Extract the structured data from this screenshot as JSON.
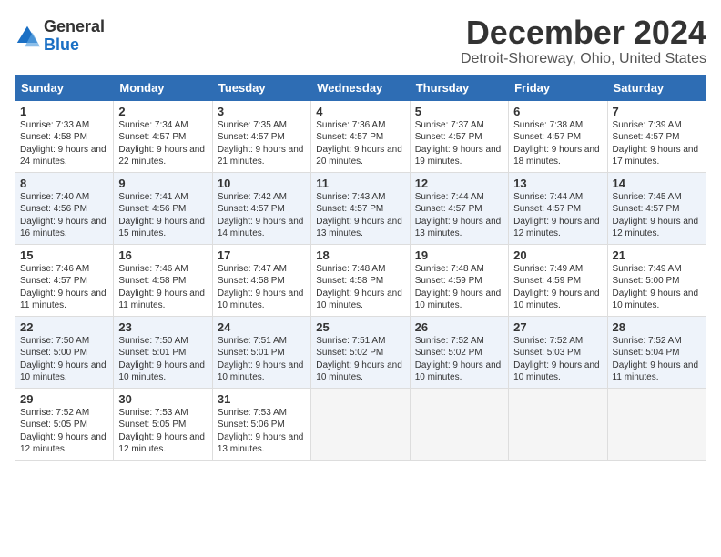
{
  "header": {
    "logo_line1": "General",
    "logo_line2": "Blue",
    "month": "December 2024",
    "location": "Detroit-Shoreway, Ohio, United States"
  },
  "days_of_week": [
    "Sunday",
    "Monday",
    "Tuesday",
    "Wednesday",
    "Thursday",
    "Friday",
    "Saturday"
  ],
  "weeks": [
    [
      {
        "day": "1",
        "sunrise": "7:33 AM",
        "sunset": "4:58 PM",
        "daylight": "9 hours and 24 minutes."
      },
      {
        "day": "2",
        "sunrise": "7:34 AM",
        "sunset": "4:57 PM",
        "daylight": "9 hours and 22 minutes."
      },
      {
        "day": "3",
        "sunrise": "7:35 AM",
        "sunset": "4:57 PM",
        "daylight": "9 hours and 21 minutes."
      },
      {
        "day": "4",
        "sunrise": "7:36 AM",
        "sunset": "4:57 PM",
        "daylight": "9 hours and 20 minutes."
      },
      {
        "day": "5",
        "sunrise": "7:37 AM",
        "sunset": "4:57 PM",
        "daylight": "9 hours and 19 minutes."
      },
      {
        "day": "6",
        "sunrise": "7:38 AM",
        "sunset": "4:57 PM",
        "daylight": "9 hours and 18 minutes."
      },
      {
        "day": "7",
        "sunrise": "7:39 AM",
        "sunset": "4:57 PM",
        "daylight": "9 hours and 17 minutes."
      }
    ],
    [
      {
        "day": "8",
        "sunrise": "7:40 AM",
        "sunset": "4:56 PM",
        "daylight": "9 hours and 16 minutes."
      },
      {
        "day": "9",
        "sunrise": "7:41 AM",
        "sunset": "4:56 PM",
        "daylight": "9 hours and 15 minutes."
      },
      {
        "day": "10",
        "sunrise": "7:42 AM",
        "sunset": "4:57 PM",
        "daylight": "9 hours and 14 minutes."
      },
      {
        "day": "11",
        "sunrise": "7:43 AM",
        "sunset": "4:57 PM",
        "daylight": "9 hours and 13 minutes."
      },
      {
        "day": "12",
        "sunrise": "7:44 AM",
        "sunset": "4:57 PM",
        "daylight": "9 hours and 13 minutes."
      },
      {
        "day": "13",
        "sunrise": "7:44 AM",
        "sunset": "4:57 PM",
        "daylight": "9 hours and 12 minutes."
      },
      {
        "day": "14",
        "sunrise": "7:45 AM",
        "sunset": "4:57 PM",
        "daylight": "9 hours and 12 minutes."
      }
    ],
    [
      {
        "day": "15",
        "sunrise": "7:46 AM",
        "sunset": "4:57 PM",
        "daylight": "9 hours and 11 minutes."
      },
      {
        "day": "16",
        "sunrise": "7:46 AM",
        "sunset": "4:58 PM",
        "daylight": "9 hours and 11 minutes."
      },
      {
        "day": "17",
        "sunrise": "7:47 AM",
        "sunset": "4:58 PM",
        "daylight": "9 hours and 10 minutes."
      },
      {
        "day": "18",
        "sunrise": "7:48 AM",
        "sunset": "4:58 PM",
        "daylight": "9 hours and 10 minutes."
      },
      {
        "day": "19",
        "sunrise": "7:48 AM",
        "sunset": "4:59 PM",
        "daylight": "9 hours and 10 minutes."
      },
      {
        "day": "20",
        "sunrise": "7:49 AM",
        "sunset": "4:59 PM",
        "daylight": "9 hours and 10 minutes."
      },
      {
        "day": "21",
        "sunrise": "7:49 AM",
        "sunset": "5:00 PM",
        "daylight": "9 hours and 10 minutes."
      }
    ],
    [
      {
        "day": "22",
        "sunrise": "7:50 AM",
        "sunset": "5:00 PM",
        "daylight": "9 hours and 10 minutes."
      },
      {
        "day": "23",
        "sunrise": "7:50 AM",
        "sunset": "5:01 PM",
        "daylight": "9 hours and 10 minutes."
      },
      {
        "day": "24",
        "sunrise": "7:51 AM",
        "sunset": "5:01 PM",
        "daylight": "9 hours and 10 minutes."
      },
      {
        "day": "25",
        "sunrise": "7:51 AM",
        "sunset": "5:02 PM",
        "daylight": "9 hours and 10 minutes."
      },
      {
        "day": "26",
        "sunrise": "7:52 AM",
        "sunset": "5:02 PM",
        "daylight": "9 hours and 10 minutes."
      },
      {
        "day": "27",
        "sunrise": "7:52 AM",
        "sunset": "5:03 PM",
        "daylight": "9 hours and 10 minutes."
      },
      {
        "day": "28",
        "sunrise": "7:52 AM",
        "sunset": "5:04 PM",
        "daylight": "9 hours and 11 minutes."
      }
    ],
    [
      {
        "day": "29",
        "sunrise": "7:52 AM",
        "sunset": "5:05 PM",
        "daylight": "9 hours and 12 minutes."
      },
      {
        "day": "30",
        "sunrise": "7:53 AM",
        "sunset": "5:05 PM",
        "daylight": "9 hours and 12 minutes."
      },
      {
        "day": "31",
        "sunrise": "7:53 AM",
        "sunset": "5:06 PM",
        "daylight": "9 hours and 13 minutes."
      },
      null,
      null,
      null,
      null
    ]
  ]
}
